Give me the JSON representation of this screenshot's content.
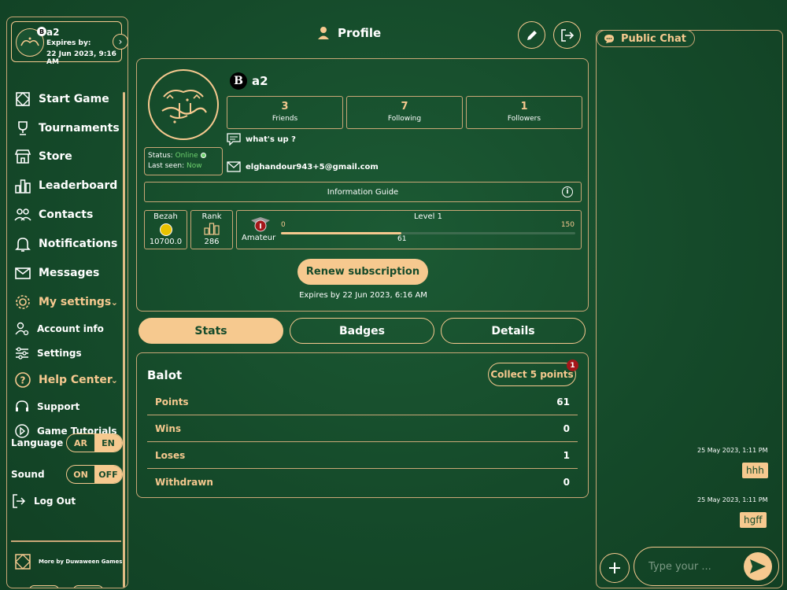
{
  "user_card": {
    "name": "a2",
    "badge": "B",
    "expires_label": "Expires by:",
    "expires_value": "22 Jun 2023, 9:16 AM"
  },
  "sidebar": {
    "items": [
      {
        "label": "Start Game",
        "icon": "board-icon"
      },
      {
        "label": "Tournaments",
        "icon": "trophy-icon"
      },
      {
        "label": "Store",
        "icon": "store-icon"
      },
      {
        "label": "Leaderboard",
        "icon": "leaderboard-icon"
      },
      {
        "label": "Contacts",
        "icon": "contacts-icon"
      },
      {
        "label": "Notifications",
        "icon": "bell-icon"
      },
      {
        "label": "Messages",
        "icon": "envelope-icon"
      },
      {
        "label": "My settings",
        "icon": "gear-icon"
      },
      {
        "label": "Account info",
        "icon": "account-icon"
      },
      {
        "label": "Settings",
        "icon": "sliders-icon"
      },
      {
        "label": "Help Center",
        "icon": "help-icon"
      },
      {
        "label": "Support",
        "icon": "support-icon"
      },
      {
        "label": "Game Tutorials",
        "icon": "play-icon"
      }
    ],
    "language": {
      "label": "Language",
      "options": [
        "AR",
        "EN"
      ],
      "selected": "EN"
    },
    "sound": {
      "label": "Sound",
      "options": [
        "ON",
        "OFF"
      ],
      "selected": "OFF"
    },
    "logout": "Log Out",
    "more_by": "More by Duwaween Games"
  },
  "header": {
    "title": "Profile"
  },
  "profile": {
    "badge": "B",
    "name": "a2",
    "status_label": "Status:",
    "status_value": "Online",
    "last_seen_label": "Last seen:",
    "last_seen_value": "Now",
    "stats": [
      {
        "value": "3",
        "label": "Friends"
      },
      {
        "value": "7",
        "label": "Following"
      },
      {
        "value": "1",
        "label": "Followers"
      }
    ],
    "bio": "what's up ?",
    "email": "elghandour943+5@gmail.com",
    "info_guide": "Information Guide",
    "bezah_label": "Bezah",
    "bezah_value": "10700.0",
    "rank_label": "Rank",
    "rank_value": "286",
    "tier": "Amateur",
    "level_label": "Level 1",
    "level_min": "0",
    "level_max": "150",
    "level_value": "61",
    "level_fraction": 0.41,
    "renew_button": "Renew subscription",
    "expires_text": "Expires by 22 Jun 2023, 6:16 AM"
  },
  "tabs": [
    "Stats",
    "Badges",
    "Details"
  ],
  "stats_panel": {
    "title": "Balot",
    "collect_button": "Collect 5 points",
    "collect_badge": "1",
    "rows": [
      {
        "key": "Points",
        "value": "61"
      },
      {
        "key": "Wins",
        "value": "0"
      },
      {
        "key": "Loses",
        "value": "1"
      },
      {
        "key": "Withdrawn",
        "value": "0"
      }
    ]
  },
  "chat": {
    "tab_label": "Public Chat",
    "messages": [
      {
        "time": "25 May 2023, 1:11 PM",
        "text": "hhh"
      },
      {
        "time": "25 May 2023, 1:11 PM",
        "text": "hgff"
      }
    ],
    "placeholder": "Type your ..."
  },
  "colors": {
    "accent": "#f6c98f",
    "background": "#154a2a",
    "border": "#c9a777",
    "online": "#6fd36f",
    "badge_red": "#a5161a"
  }
}
